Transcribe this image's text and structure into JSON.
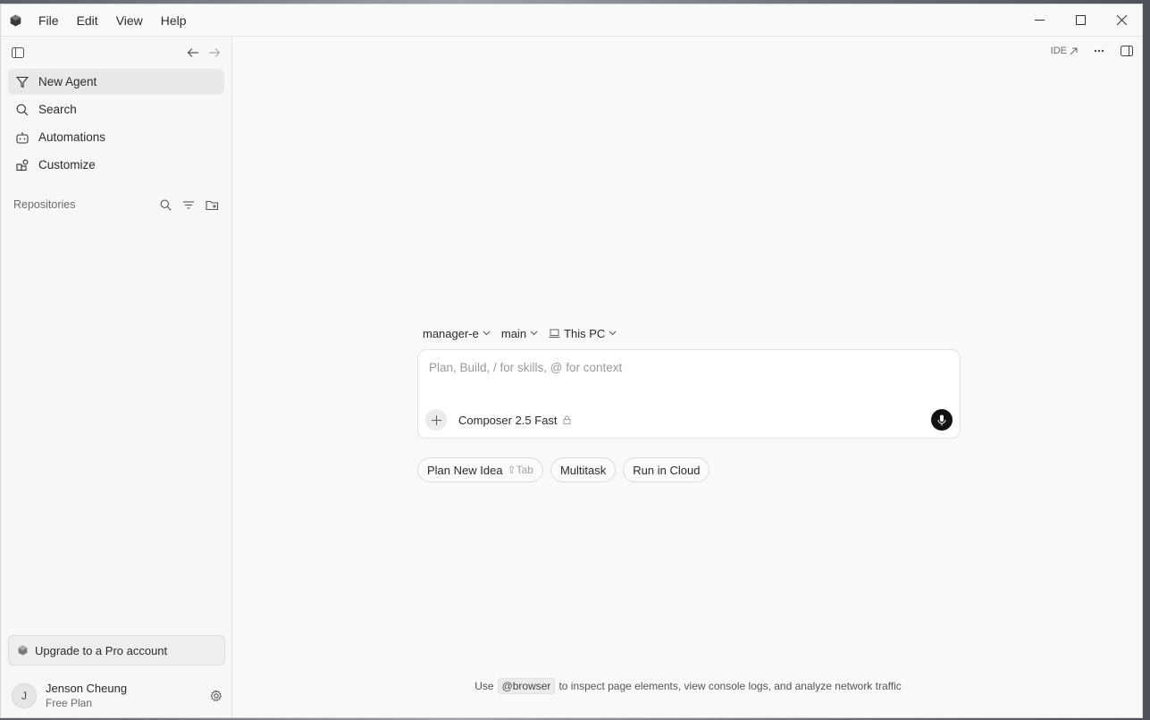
{
  "menu": {
    "file": "File",
    "edit": "Edit",
    "view": "View",
    "help": "Help"
  },
  "sidebar": {
    "items": [
      {
        "label": "New Agent",
        "icon": "funnel-icon",
        "active": true
      },
      {
        "label": "Search",
        "icon": "search-icon"
      },
      {
        "label": "Automations",
        "icon": "robot-icon"
      },
      {
        "label": "Customize",
        "icon": "blocks-icon"
      }
    ],
    "repositories_label": "Repositories",
    "upgrade_label": "Upgrade to a Pro account",
    "user": {
      "initial": "J",
      "name": "Jenson Cheung",
      "plan": "Free Plan"
    }
  },
  "main": {
    "ide_label": "IDE",
    "context": {
      "repo": "manager-e",
      "branch": "main",
      "machine": "This PC"
    },
    "composer": {
      "placeholder": "Plan, Build, / for skills, @ for context",
      "model": "Composer 2.5 Fast"
    },
    "pills": [
      {
        "label": "Plan New Idea",
        "hint": "⇧Tab"
      },
      {
        "label": "Multitask"
      },
      {
        "label": "Run in Cloud"
      }
    ],
    "tip": {
      "prefix": "Use",
      "tag": "@browser",
      "suffix": "to inspect page elements, view console logs, and analyze network traffic"
    }
  }
}
